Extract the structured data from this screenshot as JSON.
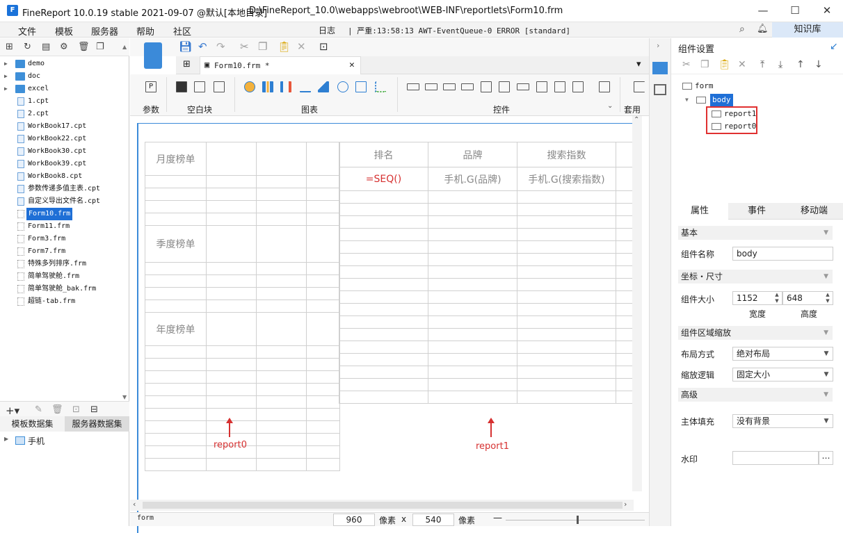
{
  "window": {
    "app_title": "FineReport 10.0.19 stable 2021-09-07 @默认[本地目录]",
    "file_path": "D:\\FineReport_10.0\\webapps\\webroot\\WEB-INF\\reportlets\\Form10.frm",
    "minimize": "—",
    "maximize": "☐",
    "close": "✕"
  },
  "menu": {
    "items": [
      "文件",
      "模板",
      "服务器",
      "帮助",
      "社区"
    ],
    "log_label": "日志",
    "log_text": "| 严重:13:58:13 AWT-EventQueue-0 ERROR [standard]",
    "knowledge_label": "知识库"
  },
  "file_tree": {
    "items": [
      {
        "name": "demo",
        "type": "folder"
      },
      {
        "name": "doc",
        "type": "folder"
      },
      {
        "name": "excel",
        "type": "folder"
      },
      {
        "name": "1.cpt",
        "type": "cpt"
      },
      {
        "name": "2.cpt",
        "type": "cpt"
      },
      {
        "name": "WorkBook17.cpt",
        "type": "cpt"
      },
      {
        "name": "WorkBook22.cpt",
        "type": "cpt"
      },
      {
        "name": "WorkBook30.cpt",
        "type": "cpt"
      },
      {
        "name": "WorkBook39.cpt",
        "type": "cpt"
      },
      {
        "name": "WorkBook8.cpt",
        "type": "cpt"
      },
      {
        "name": "参数传递多值主表.cpt",
        "type": "cpt"
      },
      {
        "name": "自定义导出文件名.cpt",
        "type": "cpt"
      },
      {
        "name": "Form10.frm",
        "type": "frm",
        "selected": true
      },
      {
        "name": "Form11.frm",
        "type": "frm"
      },
      {
        "name": "Form3.frm",
        "type": "frm"
      },
      {
        "name": "Form7.frm",
        "type": "frm"
      },
      {
        "name": "特殊多列排序.frm",
        "type": "frm"
      },
      {
        "name": "简单驾驶舱.frm",
        "type": "frm"
      },
      {
        "name": "简单驾驶舱_bak.frm",
        "type": "frm"
      },
      {
        "name": "超链-tab.frm",
        "type": "frm"
      }
    ]
  },
  "datasets": {
    "tab_template": "模板数据集",
    "tab_server": "服务器数据集",
    "items": [
      "手机"
    ]
  },
  "editor": {
    "tab_label": "Form10.frm *",
    "ribbon_labels": {
      "param": "参数",
      "blank": "空白块",
      "chart": "图表",
      "widget": "控件",
      "apply": "套用"
    }
  },
  "canvas": {
    "report0": {
      "labels": [
        "月度榜单",
        "季度榜单",
        "年度榜单"
      ],
      "annotation": "report0"
    },
    "report1": {
      "headers": [
        "排名",
        "品牌",
        "搜索指数"
      ],
      "row1": [
        "=SEQ()",
        "手机.G(品牌)",
        "手机.G(搜索指数)"
      ],
      "annotation": "report1"
    }
  },
  "status_bar": {
    "form_label": "form",
    "width_value": "960",
    "px_unit": "像素",
    "x_sep": "x",
    "height_value": "540",
    "px_unit2": "像素"
  },
  "right_panel": {
    "title": "组件设置",
    "tree": {
      "root": "form",
      "body": "body",
      "children": [
        "report1",
        "report0"
      ]
    },
    "tabs": [
      "属性",
      "事件",
      "移动端"
    ],
    "sections": {
      "basic": "基本",
      "position": "坐标・尺寸",
      "scaling": "组件区域缩放",
      "advanced": "高级"
    },
    "fields": {
      "name_label": "组件名称",
      "name_value": "body",
      "size_label": "组件大小",
      "width_value": "1152",
      "width_caption": "宽度",
      "height_value": "648",
      "height_caption": "高度",
      "layout_label": "布局方式",
      "layout_value": "绝对布局",
      "scale_label": "缩放逻辑",
      "scale_value": "固定大小",
      "fill_label": "主体填充",
      "fill_value": "没有背景",
      "watermark_label": "水印",
      "watermark_value": ""
    }
  }
}
